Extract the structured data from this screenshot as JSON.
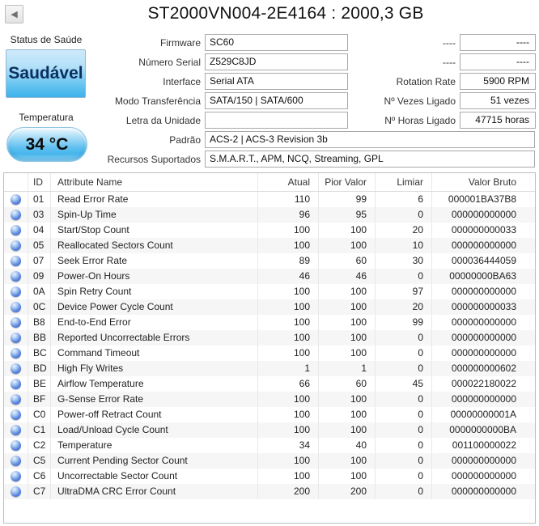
{
  "header": {
    "title": "ST2000VN004-2E4164 : 2000,3 GB",
    "back_icon": "◀"
  },
  "status": {
    "health_label": "Status de Saúde",
    "health_value": "Saudável",
    "temperature_label": "Temperatura",
    "temperature_value": "34 °C"
  },
  "colors": {
    "health_button_blue": "#3db2ea",
    "temperature_pill_blue": "#47b6ed",
    "health_text_navy": "#0b2f5e",
    "orb_blue": "#2f58c0"
  },
  "info_fields": [
    {
      "label": "Firmware",
      "value": "SC60",
      "wide": false
    },
    {
      "label": "Número Serial",
      "value": "Z529C8JD",
      "wide": false
    },
    {
      "label": "Interface",
      "value": "Serial ATA",
      "wide": false
    },
    {
      "label": "Modo Transferência",
      "value": "SATA/150 | SATA/600",
      "wide": false
    },
    {
      "label": "Letra da Unidade",
      "value": "",
      "wide": false
    },
    {
      "label": "Padrão",
      "value": "ACS-2 | ACS-3 Revision 3b",
      "wide": true
    },
    {
      "label": "Recursos Suportados",
      "value": "S.M.A.R.T., APM, NCQ, Streaming, GPL",
      "wide": true
    }
  ],
  "side_fields": [
    {
      "label": "----",
      "value": "----"
    },
    {
      "label": "----",
      "value": "----"
    },
    {
      "label": "Rotation Rate",
      "value": "5900 RPM"
    },
    {
      "label": "Nº Vezes Ligado",
      "value": "51 vezes"
    },
    {
      "label": "Nº Horas Ligado",
      "value": "47715 horas"
    }
  ],
  "smart_table": {
    "headers": {
      "id": "ID",
      "name": "Attribute Name",
      "atual": "Atual",
      "pior": "Pior Valor",
      "limiar": "Limiar",
      "bruto": "Valor Bruto"
    },
    "rows": [
      {
        "id": "01",
        "name": "Read Error Rate",
        "atual": "110",
        "pior": "99",
        "limiar": "6",
        "bruto": "000001BA37B8"
      },
      {
        "id": "03",
        "name": "Spin-Up Time",
        "atual": "96",
        "pior": "95",
        "limiar": "0",
        "bruto": "000000000000"
      },
      {
        "id": "04",
        "name": "Start/Stop Count",
        "atual": "100",
        "pior": "100",
        "limiar": "20",
        "bruto": "000000000033"
      },
      {
        "id": "05",
        "name": "Reallocated Sectors Count",
        "atual": "100",
        "pior": "100",
        "limiar": "10",
        "bruto": "000000000000"
      },
      {
        "id": "07",
        "name": "Seek Error Rate",
        "atual": "89",
        "pior": "60",
        "limiar": "30",
        "bruto": "000036444059"
      },
      {
        "id": "09",
        "name": "Power-On Hours",
        "atual": "46",
        "pior": "46",
        "limiar": "0",
        "bruto": "00000000BA63"
      },
      {
        "id": "0A",
        "name": "Spin Retry Count",
        "atual": "100",
        "pior": "100",
        "limiar": "97",
        "bruto": "000000000000"
      },
      {
        "id": "0C",
        "name": "Device Power Cycle Count",
        "atual": "100",
        "pior": "100",
        "limiar": "20",
        "bruto": "000000000033"
      },
      {
        "id": "B8",
        "name": "End-to-End Error",
        "atual": "100",
        "pior": "100",
        "limiar": "99",
        "bruto": "000000000000"
      },
      {
        "id": "BB",
        "name": "Reported Uncorrectable Errors",
        "atual": "100",
        "pior": "100",
        "limiar": "0",
        "bruto": "000000000000"
      },
      {
        "id": "BC",
        "name": "Command Timeout",
        "atual": "100",
        "pior": "100",
        "limiar": "0",
        "bruto": "000000000000"
      },
      {
        "id": "BD",
        "name": "High Fly Writes",
        "atual": "1",
        "pior": "1",
        "limiar": "0",
        "bruto": "000000000602"
      },
      {
        "id": "BE",
        "name": "Airflow Temperature",
        "atual": "66",
        "pior": "60",
        "limiar": "45",
        "bruto": "000022180022"
      },
      {
        "id": "BF",
        "name": "G-Sense Error Rate",
        "atual": "100",
        "pior": "100",
        "limiar": "0",
        "bruto": "000000000000"
      },
      {
        "id": "C0",
        "name": "Power-off Retract Count",
        "atual": "100",
        "pior": "100",
        "limiar": "0",
        "bruto": "00000000001A"
      },
      {
        "id": "C1",
        "name": "Load/Unload Cycle Count",
        "atual": "100",
        "pior": "100",
        "limiar": "0",
        "bruto": "0000000000BA"
      },
      {
        "id": "C2",
        "name": "Temperature",
        "atual": "34",
        "pior": "40",
        "limiar": "0",
        "bruto": "001100000022"
      },
      {
        "id": "C5",
        "name": "Current Pending Sector Count",
        "atual": "100",
        "pior": "100",
        "limiar": "0",
        "bruto": "000000000000"
      },
      {
        "id": "C6",
        "name": "Uncorrectable Sector Count",
        "atual": "100",
        "pior": "100",
        "limiar": "0",
        "bruto": "000000000000"
      },
      {
        "id": "C7",
        "name": "UltraDMA CRC Error Count",
        "atual": "200",
        "pior": "200",
        "limiar": "0",
        "bruto": "000000000000"
      }
    ]
  }
}
